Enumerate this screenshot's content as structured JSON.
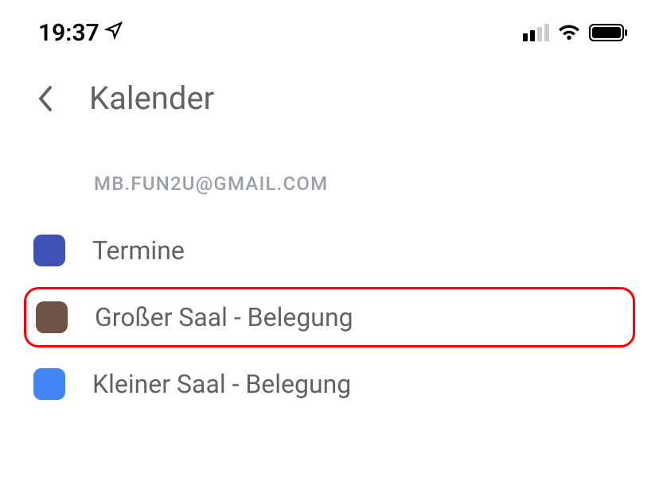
{
  "statusBar": {
    "time": "19:37"
  },
  "header": {
    "title": "Kalender"
  },
  "account": {
    "email": "MB.FUN2U@GMAIL.COM"
  },
  "calendars": [
    {
      "name": "Termine",
      "color": "#3f51b5",
      "highlighted": false
    },
    {
      "name": "Großer Saal - Belegung",
      "color": "#6d5246",
      "highlighted": true
    },
    {
      "name": "Kleiner Saal - Belegung",
      "color": "#4285f4",
      "highlighted": false
    }
  ]
}
